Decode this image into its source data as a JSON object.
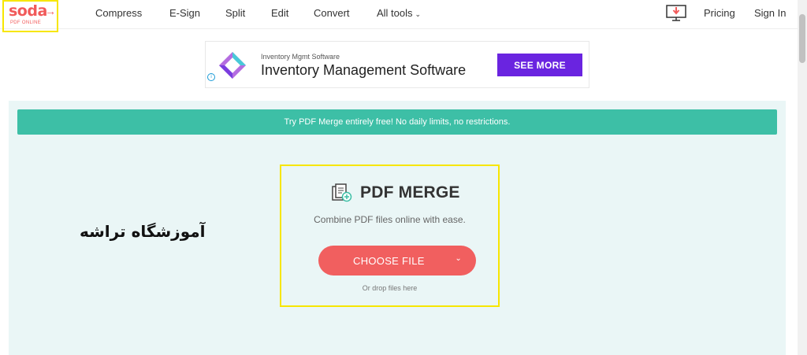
{
  "header": {
    "logo_word": "soda",
    "logo_sub": "PDF ONLINE",
    "nav": [
      "Compress",
      "E-Sign",
      "Split",
      "Edit",
      "Convert",
      "All tools"
    ],
    "pricing": "Pricing",
    "sign_in": "Sign In"
  },
  "ad": {
    "small": "Inventory Mgmt Software",
    "title": "Inventory Management Software",
    "button": "SEE MORE",
    "info": "i"
  },
  "banner": {
    "text": "Try PDF Merge entirely free! No daily limits, no restrictions."
  },
  "side_text": "آموزشگاه تراشه",
  "tool": {
    "title": "PDF MERGE",
    "subtitle": "Combine PDF files online with ease.",
    "choose_label": "CHOOSE FILE",
    "drop_text": "Or drop files here"
  },
  "colors": {
    "accent_red": "#f15f5f",
    "banner_teal": "#3dbfa6",
    "ad_purple": "#6a24e0",
    "highlight_yellow": "#f7e600",
    "main_bg": "#eaf6f6"
  }
}
